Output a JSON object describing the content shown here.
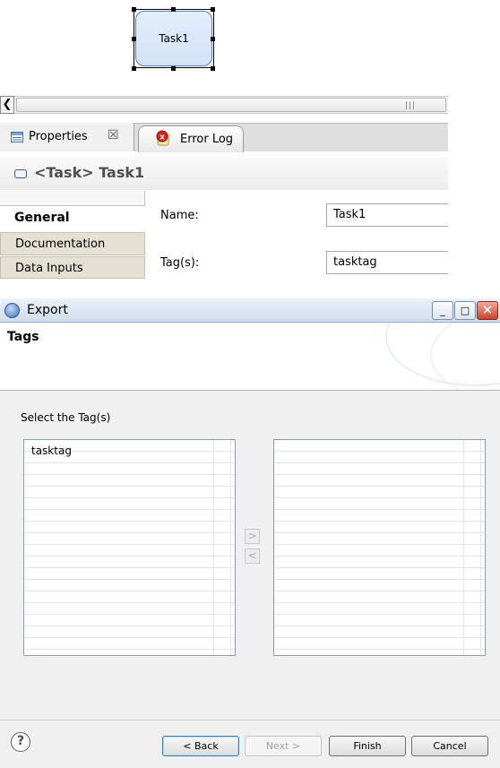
{
  "diagram": {
    "task_label": "Task1"
  },
  "properties": {
    "tab_properties": "Properties",
    "tab_properties_close": "☒",
    "tab_error_log": "Error Log",
    "title": "<Task> Task1",
    "sidebar": [
      "General",
      "Documentation",
      "Data Inputs"
    ],
    "name_label": "Name:",
    "name_value": "Task1",
    "tags_label": "Tag(s):",
    "tags_value": "tasktag"
  },
  "dialog": {
    "title": "Export",
    "header": "Tags",
    "select_label": "Select the Tag(s)",
    "available_tags": [
      "tasktag"
    ],
    "selected_tags": [],
    "buttons": {
      "back": "< Back",
      "next": "Next >",
      "finish": "Finish",
      "cancel": "Cancel"
    },
    "help": "?",
    "win_minimize": "_",
    "win_maximize": "□",
    "win_close": "✕",
    "arrow_add": ">",
    "arrow_remove": "<"
  }
}
